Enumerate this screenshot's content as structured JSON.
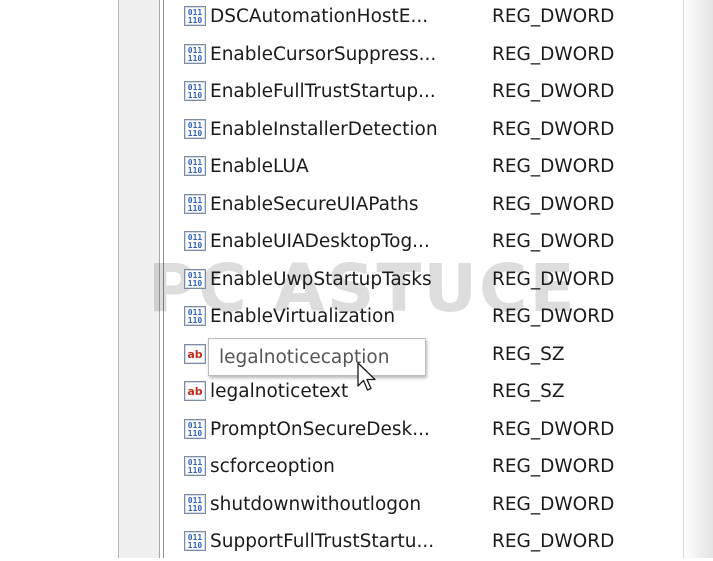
{
  "watermark": "PC ASTUCES",
  "rows": [
    {
      "name": "DSCAutomationHostE...",
      "type": "REG_DWORD",
      "icon": "dword-value-icon"
    },
    {
      "name": "EnableCursorSuppress...",
      "type": "REG_DWORD",
      "icon": "dword-value-icon"
    },
    {
      "name": "EnableFullTrustStartup...",
      "type": "REG_DWORD",
      "icon": "dword-value-icon"
    },
    {
      "name": "EnableInstallerDetection",
      "type": "REG_DWORD",
      "icon": "dword-value-icon"
    },
    {
      "name": "EnableLUA",
      "type": "REG_DWORD",
      "icon": "dword-value-icon"
    },
    {
      "name": "EnableSecureUIAPaths",
      "type": "REG_DWORD",
      "icon": "dword-value-icon"
    },
    {
      "name": "EnableUIADesktopTog...",
      "type": "REG_DWORD",
      "icon": "dword-value-icon"
    },
    {
      "name": "EnableUwpStartupTasks",
      "type": "REG_DWORD",
      "icon": "dword-value-icon"
    },
    {
      "name": "EnableVirtualization",
      "type": "REG_DWORD",
      "icon": "dword-value-icon"
    },
    {
      "name": "",
      "type": "REG_SZ",
      "icon": "string-value-icon"
    },
    {
      "name": "legalnoticetext",
      "type": "REG_SZ",
      "icon": "string-value-icon"
    },
    {
      "name": "PromptOnSecureDesk...",
      "type": "REG_DWORD",
      "icon": "dword-value-icon"
    },
    {
      "name": "scforceoption",
      "type": "REG_DWORD",
      "icon": "dword-value-icon"
    },
    {
      "name": "shutdownwithoutlogon",
      "type": "REG_DWORD",
      "icon": "dword-value-icon"
    },
    {
      "name": "SupportFullTrustStartu...",
      "type": "REG_DWORD",
      "icon": "dword-value-icon"
    }
  ],
  "tooltip": {
    "text": "legalnoticecaption"
  },
  "colors": {
    "dword_icon_blue": "#2f62b8",
    "string_icon_red": "#c42b1c"
  }
}
